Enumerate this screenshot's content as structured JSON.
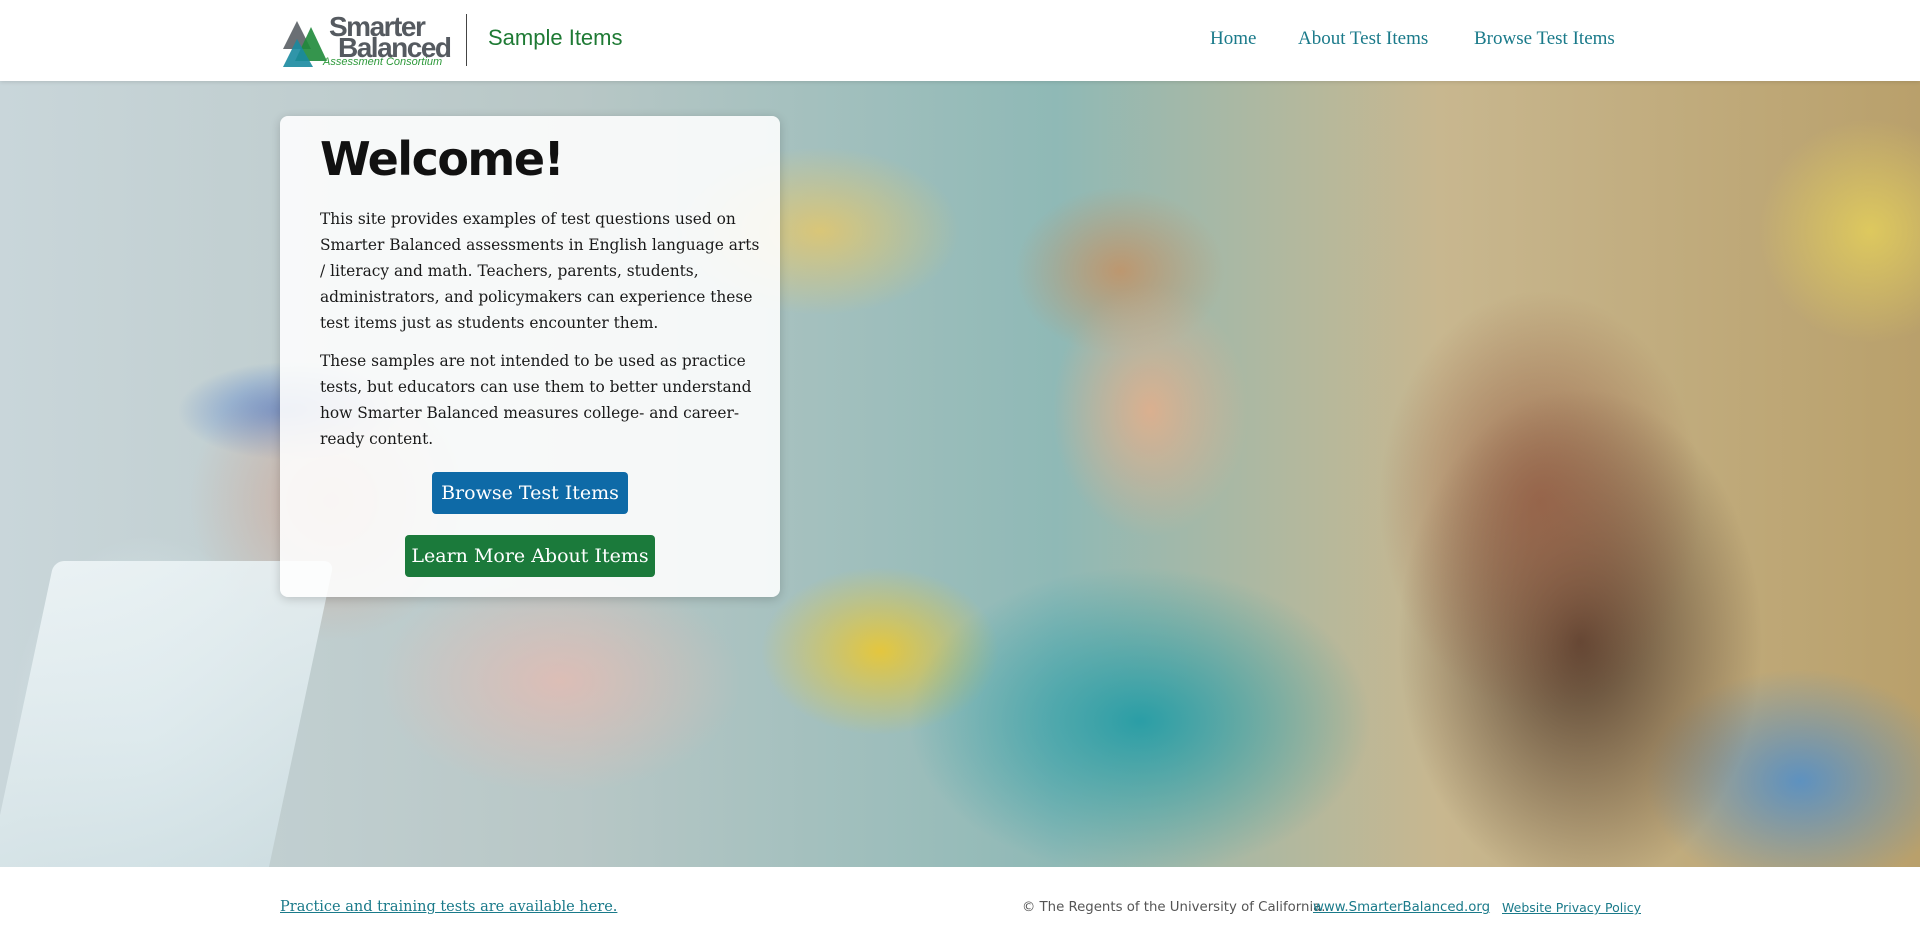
{
  "header": {
    "logo": {
      "line1": "Smarter",
      "line2": "Balanced",
      "subtitle": "Assessment Consortium"
    },
    "site_title": "Sample Items",
    "nav": {
      "home": "Home",
      "about": "About Test Items",
      "browse": "Browse Test Items"
    }
  },
  "hero": {
    "image_icon": "hero-photo-students",
    "card": {
      "title": "Welcome!",
      "paragraph1": "This site provides examples of test questions used on Smarter Balanced assessments in English language arts / literacy and math. Teachers, parents, students, administrators, and policymakers can experience these test items just as students encounter them.",
      "paragraph2": "These samples are not intended to be used as practice tests, but educators can use them to better understand how Smarter Balanced measures college- and career-ready content.",
      "browse_button": "Browse Test Items",
      "learn_button": "Learn More About Items"
    }
  },
  "footer": {
    "practice_link": "Practice and training tests are available here.",
    "copyright": "© The Regents of the University of California.",
    "site_link": "www.SmarterBalanced.org",
    "privacy_link": "Website Privacy Policy"
  },
  "colors": {
    "nav_link": "#1a7a8a",
    "site_title": "#1e7a34",
    "browse_button": "#0e6aa7",
    "learn_button": "#1b7a3b"
  }
}
